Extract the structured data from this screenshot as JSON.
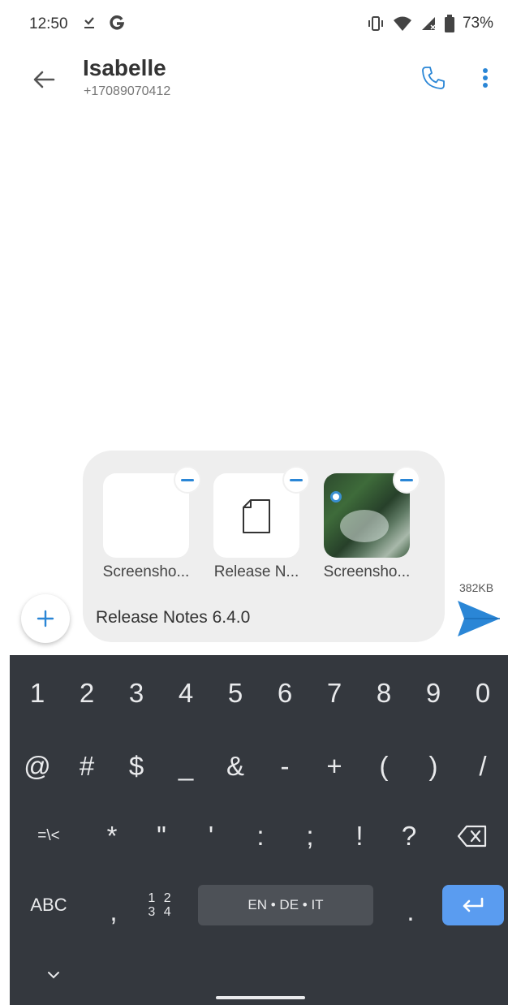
{
  "status_bar": {
    "time": "12:50",
    "battery": "73%",
    "icons": [
      "download-done-icon",
      "g-logo-icon",
      "vibrate-icon",
      "wifi-icon",
      "signal-icon",
      "battery-icon"
    ]
  },
  "header": {
    "contact_name": "Isabelle",
    "contact_number": "+17089070412",
    "icons": [
      "back-arrow-icon",
      "phone-icon",
      "more-vert-icon"
    ]
  },
  "compose": {
    "attachments": [
      {
        "label": "Screensho...",
        "kind": "blank-image"
      },
      {
        "label": "Release N...",
        "kind": "file"
      },
      {
        "label": "Screensho...",
        "kind": "photo"
      }
    ],
    "message": "Release Notes 6.4.0",
    "size": "382KB"
  },
  "keyboard": {
    "row1": [
      "1",
      "2",
      "3",
      "4",
      "5",
      "6",
      "7",
      "8",
      "9",
      "0"
    ],
    "row2": [
      "@",
      "#",
      "$",
      "_",
      "&",
      "-",
      "+",
      "(",
      ")",
      "/"
    ],
    "row3": [
      "=\\<",
      "*",
      "\"",
      "'",
      ":",
      ";",
      "!",
      "?"
    ],
    "abc": "ABC",
    "comma": ",",
    "num_top": "1 2",
    "num_bottom": "3 4",
    "space": "EN • DE • IT",
    "period": "."
  },
  "colors": {
    "accent": "#2a86d6",
    "keyboard_bg": "#34383e",
    "enter_key": "#5a9cf0"
  }
}
